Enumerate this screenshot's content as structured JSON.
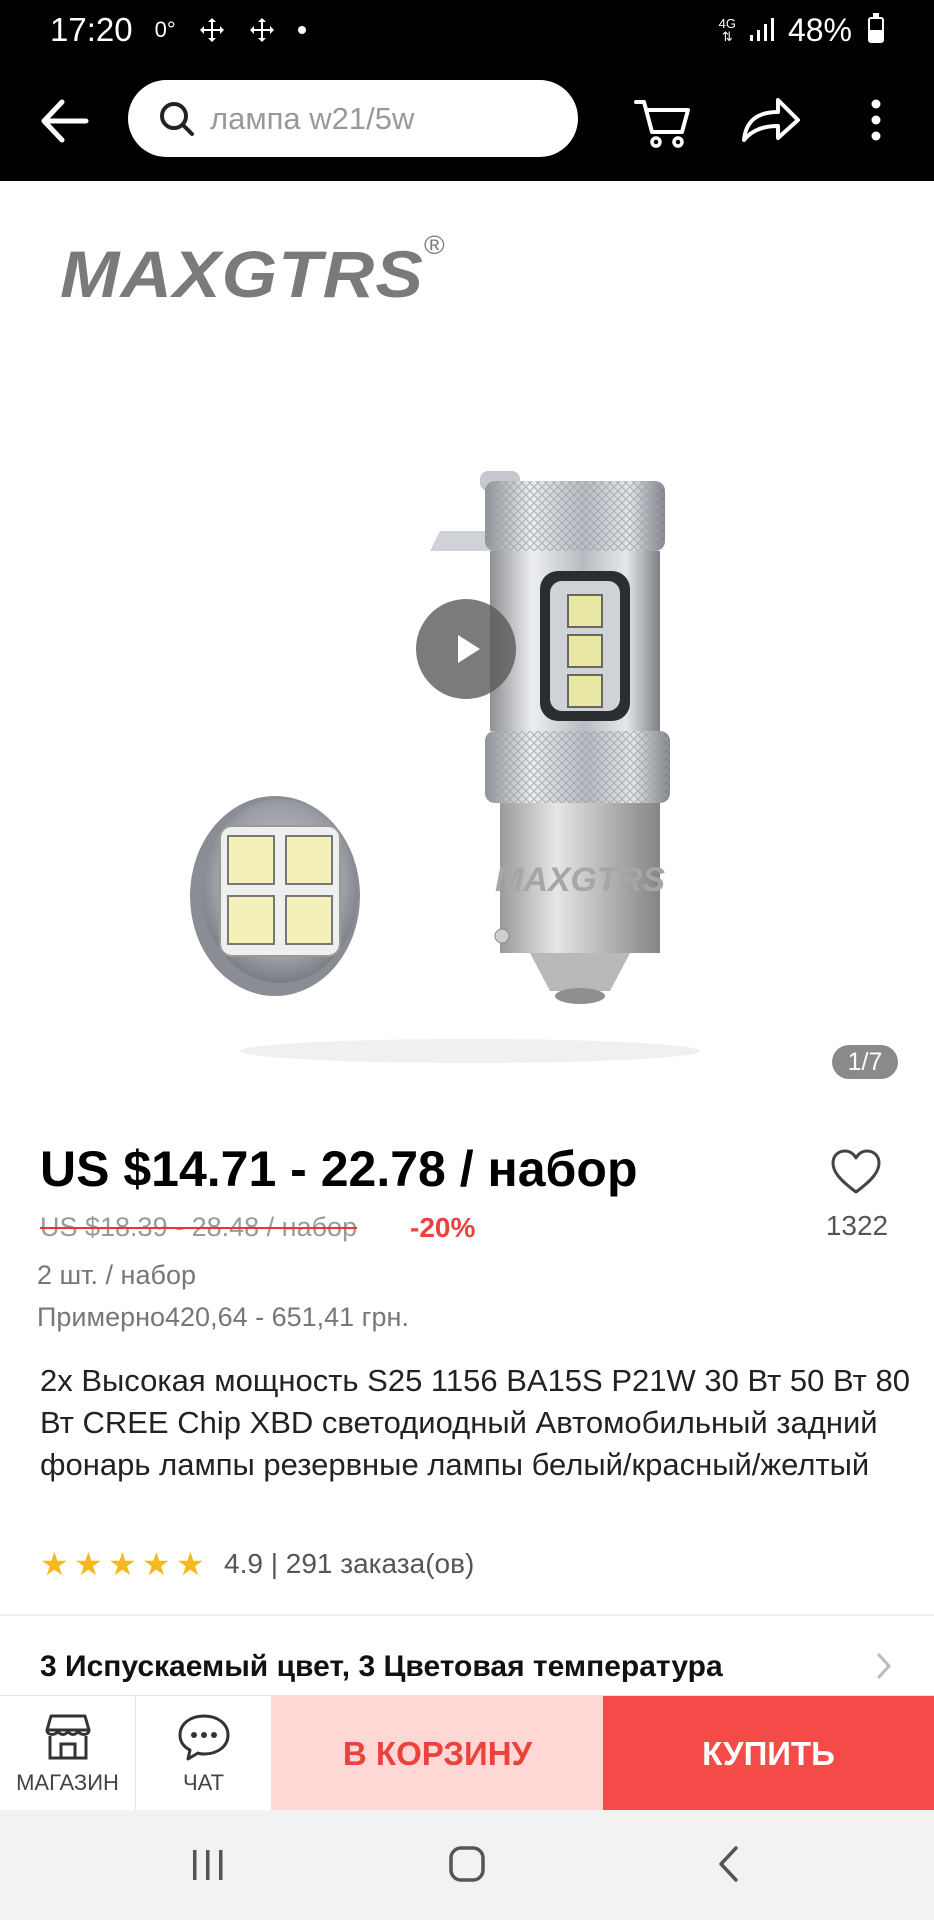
{
  "status_bar": {
    "time": "17:20",
    "notif_temp": "0°",
    "network": "4G",
    "battery": "48%",
    "battery_level": 0.48
  },
  "topbar": {
    "search_placeholder": "лампа w21/5w",
    "icons": [
      "back-arrow-icon",
      "search-icon",
      "cart-icon",
      "share-icon",
      "more-vertical-icon"
    ]
  },
  "gallery": {
    "brand": "MAXGTRS",
    "brand_mark": "®",
    "bulb_brand_print": "MAXGTRS",
    "page_counter": "1/7"
  },
  "price": {
    "current": "US $14.71 - 22.78 / набор",
    "original": "US $18.39 - 28.48 / набор",
    "discount": "-20%",
    "wishlist_count": "1322",
    "pack": "2 шт. / набор",
    "approx": "Примерно420,64 - 651,41 грн."
  },
  "product": {
    "title": "2x Высокая мощность S25 1156 BA15S P21W 30 Вт 50 Вт 80 Вт CREE Chip XBD светодиодный Автомобильный задний фонарь лампы резервные лампы белый/красный/желтый",
    "rating": "4.9",
    "orders": "| 291 заказа(ов)",
    "stars": 5,
    "variant_summary": "3 Испускаемый цвет, 3 Цветовая температура"
  },
  "action_bar": {
    "store_label": "МАГАЗИН",
    "chat_label": "ЧАТ",
    "cart_label": "В КОРЗИНУ",
    "buy_label": "КУПИТЬ"
  },
  "colors": {
    "accent_red": "#f54b48",
    "cart_bg": "#ffd8d6",
    "star_gold": "#f6b81f"
  }
}
